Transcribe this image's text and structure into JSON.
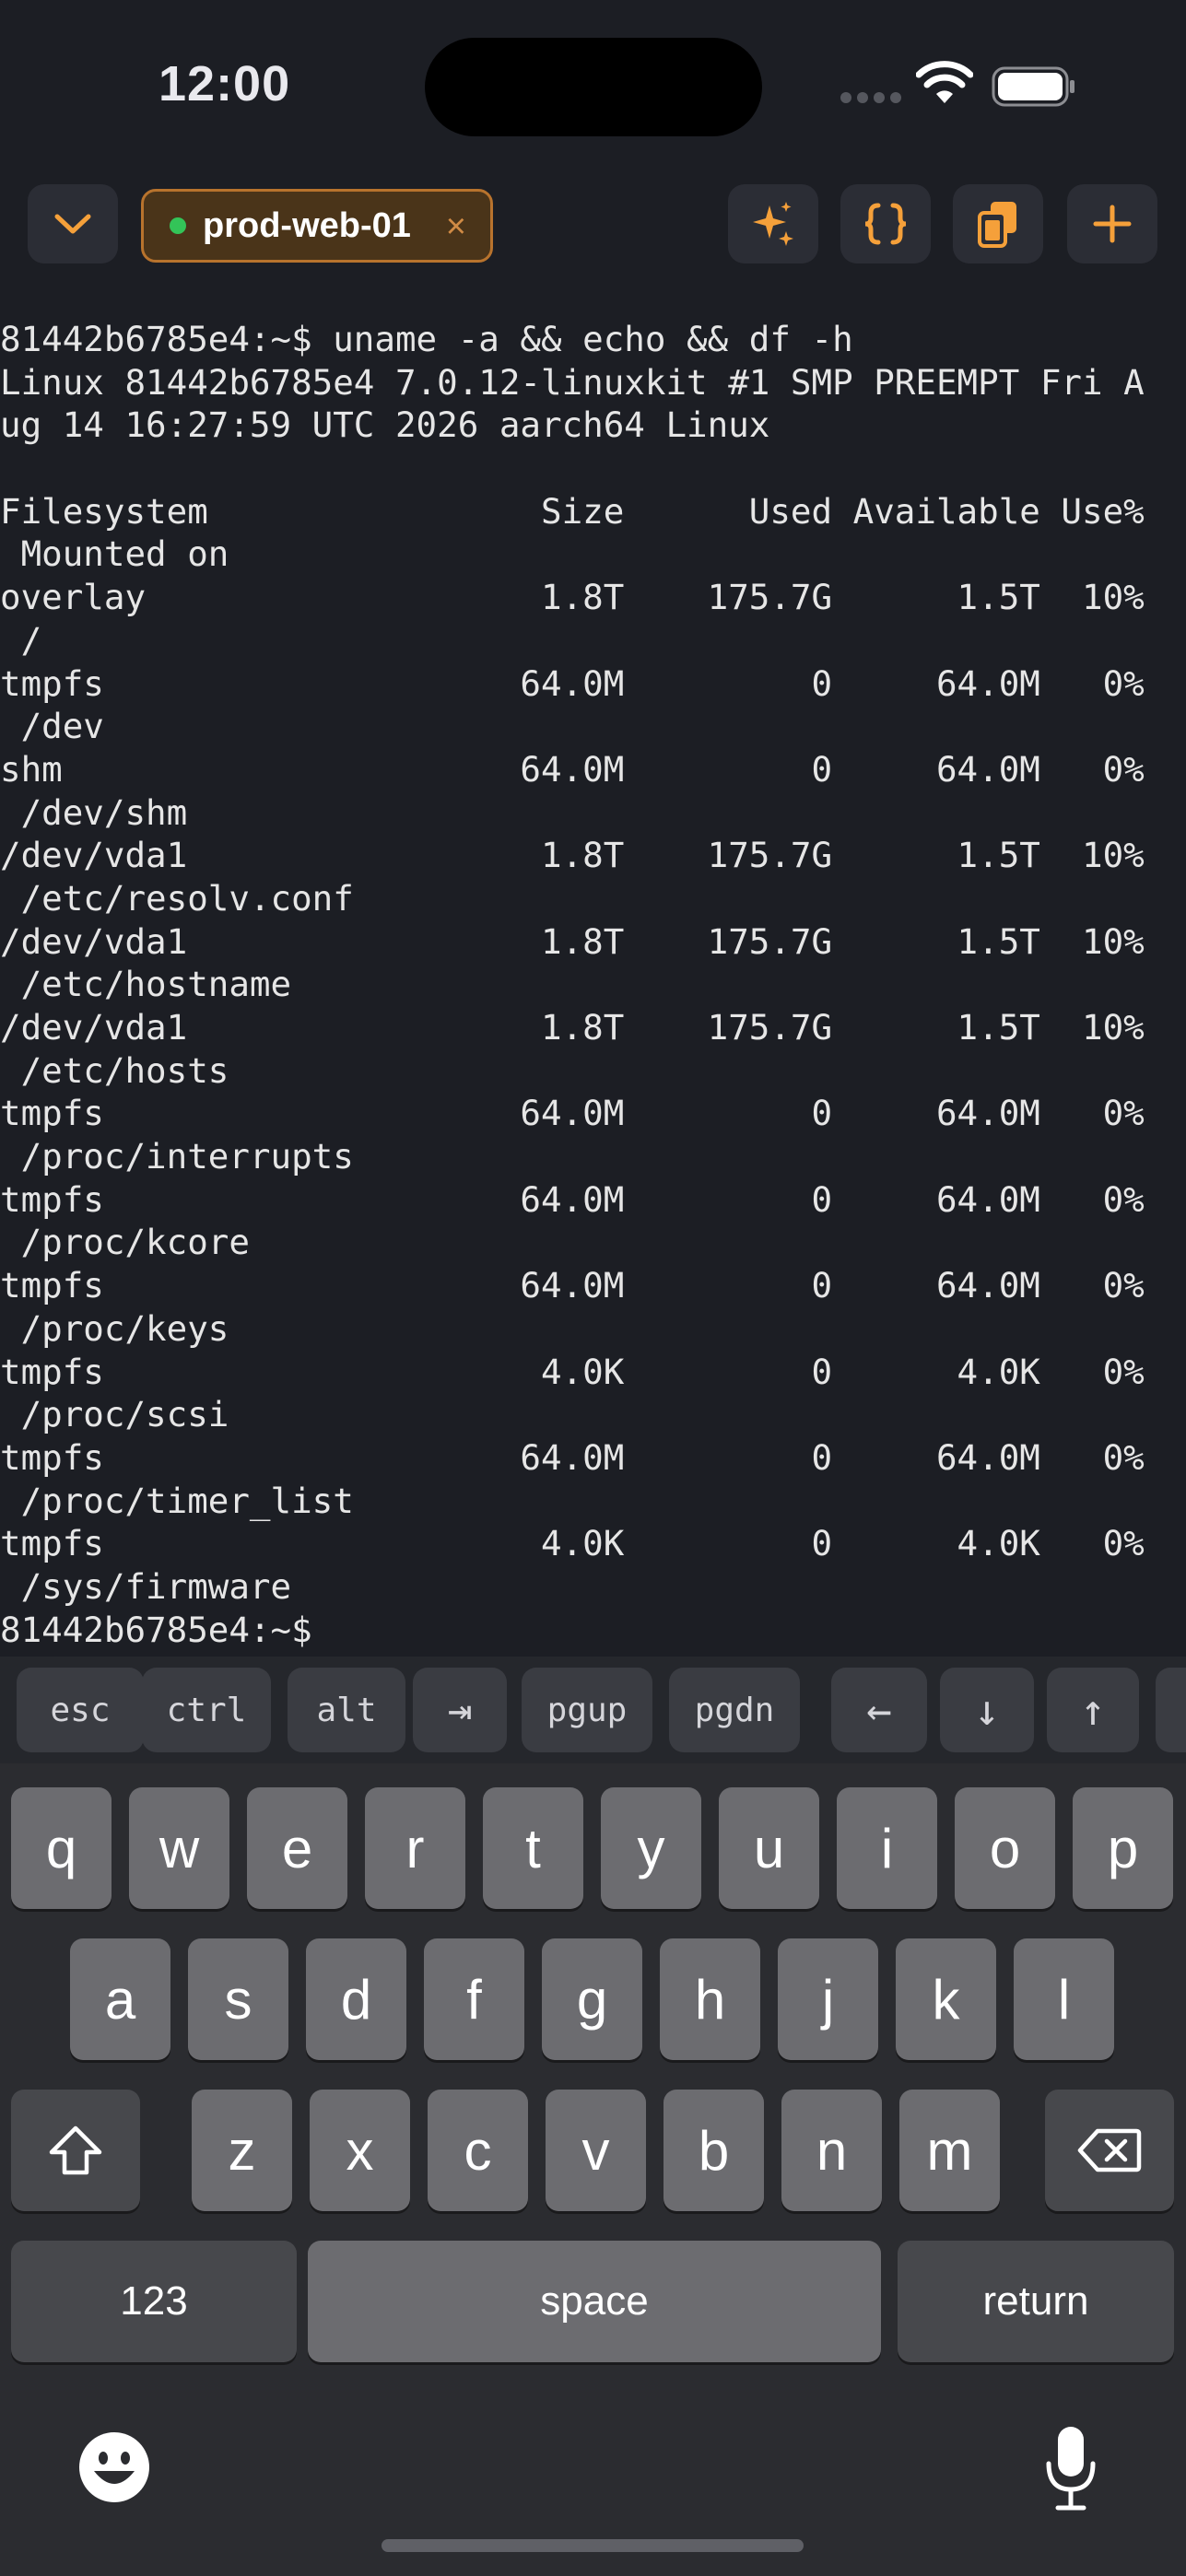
{
  "status_bar": {
    "time": "12:00"
  },
  "toolbar": {
    "collapse_icon": "chevron-down-icon",
    "session_tab": {
      "label": "prod-web-01",
      "status": "connected",
      "close_glyph": "×"
    },
    "actions": [
      {
        "name": "ai-sparkle-icon"
      },
      {
        "name": "snippets-braces-icon"
      },
      {
        "name": "clipboard-icon"
      },
      {
        "name": "add-icon"
      }
    ],
    "accent_color": "#f5a03a"
  },
  "terminal": {
    "lines": [
      "81442b6785e4:~$ uname -a && echo && df -h",
      "Linux 81442b6785e4 7.0.12-linuxkit #1 SMP PREEMPT Fri A",
      "ug 14 16:27:59 UTC 2026 aarch64 Linux",
      "",
      "Filesystem                Size      Used Available Use%",
      " Mounted on",
      "overlay                   1.8T    175.7G      1.5T  10%",
      " /",
      "tmpfs                    64.0M         0     64.0M   0%",
      " /dev",
      "shm                      64.0M         0     64.0M   0%",
      " /dev/shm",
      "/dev/vda1                 1.8T    175.7G      1.5T  10%",
      " /etc/resolv.conf",
      "/dev/vda1                 1.8T    175.7G      1.5T  10%",
      " /etc/hostname",
      "/dev/vda1                 1.8T    175.7G      1.5T  10%",
      " /etc/hosts",
      "tmpfs                    64.0M         0     64.0M   0%",
      " /proc/interrupts",
      "tmpfs                    64.0M         0     64.0M   0%",
      " /proc/kcore",
      "tmpfs                    64.0M         0     64.0M   0%",
      " /proc/keys",
      "tmpfs                     4.0K         0      4.0K   0%",
      " /proc/scsi",
      "tmpfs                    64.0M         0     64.0M   0%",
      " /proc/timer_list",
      "tmpfs                     4.0K         0      4.0K   0%",
      " /sys/firmware",
      "81442b6785e4:~$"
    ]
  },
  "accessory_bar": {
    "keys": [
      "esc",
      "ctrl",
      "alt",
      "⇥",
      "pgup",
      "pgdn",
      "←",
      "↓",
      "↑"
    ]
  },
  "keyboard": {
    "row1": [
      "q",
      "w",
      "e",
      "r",
      "t",
      "y",
      "u",
      "i",
      "o",
      "p"
    ],
    "row2": [
      "a",
      "s",
      "d",
      "f",
      "g",
      "h",
      "j",
      "k",
      "l"
    ],
    "row3": [
      "z",
      "x",
      "c",
      "v",
      "b",
      "n",
      "m"
    ],
    "numbers_label": "123",
    "space_label": "space",
    "return_label": "return"
  }
}
